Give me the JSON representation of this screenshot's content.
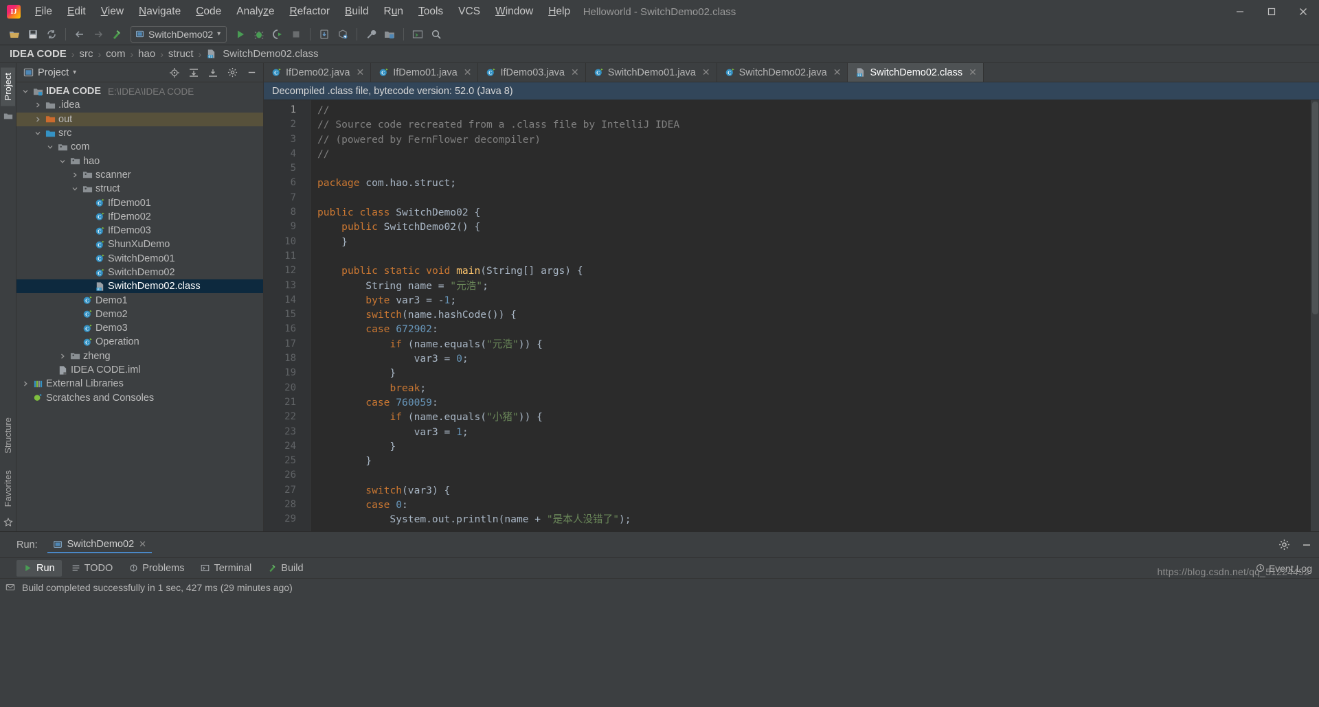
{
  "window": {
    "title": "Helloworld - SwitchDemo02.class",
    "logo_text": "IJ",
    "minimize": "–",
    "maximize": "❐",
    "close": "✕"
  },
  "menubar": {
    "items": [
      {
        "label": "File",
        "mnemonic": "F"
      },
      {
        "label": "Edit",
        "mnemonic": "E"
      },
      {
        "label": "View",
        "mnemonic": "V"
      },
      {
        "label": "Navigate",
        "mnemonic": "N"
      },
      {
        "label": "Code",
        "mnemonic": "C"
      },
      {
        "label": "Analyze",
        "mnemonic": "z"
      },
      {
        "label": "Refactor",
        "mnemonic": "R"
      },
      {
        "label": "Build",
        "mnemonic": "B"
      },
      {
        "label": "Run",
        "mnemonic": "u"
      },
      {
        "label": "Tools",
        "mnemonic": "T"
      },
      {
        "label": "VCS",
        "mnemonic": ""
      },
      {
        "label": "Window",
        "mnemonic": "W"
      },
      {
        "label": "Help",
        "mnemonic": "H"
      }
    ]
  },
  "toolbar": {
    "open_icon": "open-folder-icon",
    "save_icon": "save-icon",
    "sync_icon": "sync-icon",
    "back_icon": "back-arrow-icon",
    "forward_icon": "forward-arrow-icon",
    "build_icon": "hammer-icon",
    "run_config": "SwitchDemo02",
    "run_icon": "run-icon",
    "debug_icon": "debug-icon",
    "coverage_icon": "run-with-coverage-icon",
    "stop_icon": "stop-icon",
    "settings_icon": "wrench-icon",
    "project_structure_icon": "project-structure-icon",
    "terminal_icon": "terminal-icon",
    "search_icon": "search-everywhere-icon"
  },
  "breadcrumb": {
    "items": [
      "IDEA CODE",
      "src",
      "com",
      "hao",
      "struct",
      "SwitchDemo02.class"
    ],
    "separator": "›"
  },
  "left_strip": {
    "project_tab": "Project",
    "structure_tab": "Structure",
    "favorites_tab": "Favorites"
  },
  "project_panel": {
    "title": "Project",
    "dropdown": "▾",
    "actions": [
      "locate-icon",
      "expand-all-icon",
      "collapse-all-icon",
      "gear-icon",
      "hide-icon"
    ],
    "tree": [
      {
        "label": "IDEA CODE",
        "path": "E:\\IDEA\\IDEA CODE",
        "indent": 0,
        "arrow": "down",
        "icon": "module-folder-icon",
        "bold": true,
        "state": "normal"
      },
      {
        "label": ".idea",
        "path": "",
        "indent": 1,
        "arrow": "right",
        "icon": "folder-icon",
        "bold": false,
        "state": "normal"
      },
      {
        "label": "out",
        "path": "",
        "indent": 1,
        "arrow": "right",
        "icon": "folder-orange-icon",
        "bold": false,
        "state": "highlighted"
      },
      {
        "label": "src",
        "path": "",
        "indent": 1,
        "arrow": "down",
        "icon": "folder-source-icon",
        "bold": false,
        "state": "normal"
      },
      {
        "label": "com",
        "path": "",
        "indent": 2,
        "arrow": "down",
        "icon": "package-icon",
        "bold": false,
        "state": "normal"
      },
      {
        "label": "hao",
        "path": "",
        "indent": 3,
        "arrow": "down",
        "icon": "package-icon",
        "bold": false,
        "state": "normal"
      },
      {
        "label": "scanner",
        "path": "",
        "indent": 4,
        "arrow": "right",
        "icon": "package-icon",
        "bold": false,
        "state": "normal"
      },
      {
        "label": "struct",
        "path": "",
        "indent": 4,
        "arrow": "down",
        "icon": "package-icon",
        "bold": false,
        "state": "normal"
      },
      {
        "label": "IfDemo01",
        "path": "",
        "indent": 5,
        "arrow": "none",
        "icon": "java-class-icon",
        "bold": false,
        "state": "normal"
      },
      {
        "label": "IfDemo02",
        "path": "",
        "indent": 5,
        "arrow": "none",
        "icon": "java-class-icon",
        "bold": false,
        "state": "normal"
      },
      {
        "label": "IfDemo03",
        "path": "",
        "indent": 5,
        "arrow": "none",
        "icon": "java-class-icon",
        "bold": false,
        "state": "normal"
      },
      {
        "label": "ShunXuDemo",
        "path": "",
        "indent": 5,
        "arrow": "none",
        "icon": "java-class-icon",
        "bold": false,
        "state": "normal"
      },
      {
        "label": "SwitchDemo01",
        "path": "",
        "indent": 5,
        "arrow": "none",
        "icon": "java-class-icon",
        "bold": false,
        "state": "normal"
      },
      {
        "label": "SwitchDemo02",
        "path": "",
        "indent": 5,
        "arrow": "none",
        "icon": "java-class-icon",
        "bold": false,
        "state": "normal"
      },
      {
        "label": "SwitchDemo02.class",
        "path": "",
        "indent": 5,
        "arrow": "none",
        "icon": "class-file-icon",
        "bold": false,
        "state": "selected"
      },
      {
        "label": "Demo1",
        "path": "",
        "indent": 4,
        "arrow": "none",
        "icon": "java-class-icon",
        "bold": false,
        "state": "normal"
      },
      {
        "label": "Demo2",
        "path": "",
        "indent": 4,
        "arrow": "none",
        "icon": "java-class-icon",
        "bold": false,
        "state": "normal"
      },
      {
        "label": "Demo3",
        "path": "",
        "indent": 4,
        "arrow": "none",
        "icon": "java-class-icon",
        "bold": false,
        "state": "normal"
      },
      {
        "label": "Operation",
        "path": "",
        "indent": 4,
        "arrow": "none",
        "icon": "java-class-icon",
        "bold": false,
        "state": "normal"
      },
      {
        "label": "zheng",
        "path": "",
        "indent": 3,
        "arrow": "right",
        "icon": "package-icon",
        "bold": false,
        "state": "normal"
      },
      {
        "label": "IDEA CODE.iml",
        "path": "",
        "indent": 2,
        "arrow": "none",
        "icon": "iml-file-icon",
        "bold": false,
        "state": "normal"
      },
      {
        "label": "External Libraries",
        "path": "",
        "indent": 0,
        "arrow": "right",
        "icon": "libraries-icon",
        "bold": false,
        "state": "normal"
      },
      {
        "label": "Scratches and Consoles",
        "path": "",
        "indent": 0,
        "arrow": "none",
        "icon": "scratches-icon",
        "bold": false,
        "state": "normal"
      }
    ]
  },
  "editor": {
    "tabs": [
      {
        "label": "IfDemo02.java",
        "icon": "java-class-icon",
        "active": false,
        "close": "✕"
      },
      {
        "label": "IfDemo01.java",
        "icon": "java-class-icon",
        "active": false,
        "close": "✕"
      },
      {
        "label": "IfDemo03.java",
        "icon": "java-class-icon",
        "active": false,
        "close": "✕"
      },
      {
        "label": "SwitchDemo01.java",
        "icon": "java-class-icon",
        "active": false,
        "close": "✕"
      },
      {
        "label": "SwitchDemo02.java",
        "icon": "java-class-icon",
        "active": false,
        "close": "✕"
      },
      {
        "label": "SwitchDemo02.class",
        "icon": "class-file-icon",
        "active": true,
        "close": "✕"
      }
    ],
    "notice": "Decompiled .class file, bytecode version: 52.0 (Java 8)",
    "first_line": 1,
    "last_line": 29,
    "lines": [
      {
        "n": 1,
        "tokens": [
          {
            "t": "//",
            "c": "cm"
          }
        ]
      },
      {
        "n": 2,
        "tokens": [
          {
            "t": "// Source code recreated from a .class file by IntelliJ IDEA",
            "c": "cm"
          }
        ]
      },
      {
        "n": 3,
        "tokens": [
          {
            "t": "// (powered by FernFlower decompiler)",
            "c": "cm"
          }
        ]
      },
      {
        "n": 4,
        "tokens": [
          {
            "t": "//",
            "c": "cm"
          }
        ]
      },
      {
        "n": 5,
        "tokens": [
          {
            "t": "",
            "c": "id"
          }
        ]
      },
      {
        "n": 6,
        "tokens": [
          {
            "t": "package",
            "c": "kw"
          },
          {
            "t": " com.hao.struct;",
            "c": "id"
          }
        ]
      },
      {
        "n": 7,
        "tokens": [
          {
            "t": "",
            "c": "id"
          }
        ]
      },
      {
        "n": 8,
        "tokens": [
          {
            "t": "public class",
            "c": "kw"
          },
          {
            "t": " SwitchDemo02 {",
            "c": "id"
          }
        ]
      },
      {
        "n": 9,
        "tokens": [
          {
            "t": "    ",
            "c": "id"
          },
          {
            "t": "public",
            "c": "kw"
          },
          {
            "t": " SwitchDemo02() {",
            "c": "id"
          }
        ]
      },
      {
        "n": 10,
        "tokens": [
          {
            "t": "    }",
            "c": "id"
          }
        ]
      },
      {
        "n": 11,
        "tokens": [
          {
            "t": "",
            "c": "id"
          }
        ]
      },
      {
        "n": 12,
        "tokens": [
          {
            "t": "    ",
            "c": "id"
          },
          {
            "t": "public static void",
            "c": "kw"
          },
          {
            "t": " ",
            "c": "id"
          },
          {
            "t": "main",
            "c": "fn"
          },
          {
            "t": "(String[] args) {",
            "c": "id"
          }
        ]
      },
      {
        "n": 13,
        "tokens": [
          {
            "t": "        String name = ",
            "c": "id"
          },
          {
            "t": "\"元浩\"",
            "c": "st"
          },
          {
            "t": ";",
            "c": "id"
          }
        ]
      },
      {
        "n": 14,
        "tokens": [
          {
            "t": "        ",
            "c": "id"
          },
          {
            "t": "byte",
            "c": "kw"
          },
          {
            "t": " var3 = -",
            "c": "id"
          },
          {
            "t": "1",
            "c": "nm"
          },
          {
            "t": ";",
            "c": "id"
          }
        ]
      },
      {
        "n": 15,
        "tokens": [
          {
            "t": "        ",
            "c": "id"
          },
          {
            "t": "switch",
            "c": "kw"
          },
          {
            "t": "(name.hashCode()) {",
            "c": "id"
          }
        ]
      },
      {
        "n": 16,
        "tokens": [
          {
            "t": "        ",
            "c": "id"
          },
          {
            "t": "case",
            "c": "kw"
          },
          {
            "t": " ",
            "c": "id"
          },
          {
            "t": "672902",
            "c": "nm"
          },
          {
            "t": ":",
            "c": "id"
          }
        ]
      },
      {
        "n": 17,
        "tokens": [
          {
            "t": "            ",
            "c": "id"
          },
          {
            "t": "if",
            "c": "kw"
          },
          {
            "t": " (name.equals(",
            "c": "id"
          },
          {
            "t": "\"元浩\"",
            "c": "st"
          },
          {
            "t": ")) {",
            "c": "id"
          }
        ]
      },
      {
        "n": 18,
        "tokens": [
          {
            "t": "                var3 = ",
            "c": "id"
          },
          {
            "t": "0",
            "c": "nm"
          },
          {
            "t": ";",
            "c": "id"
          }
        ]
      },
      {
        "n": 19,
        "tokens": [
          {
            "t": "            }",
            "c": "id"
          }
        ]
      },
      {
        "n": 20,
        "tokens": [
          {
            "t": "            ",
            "c": "id"
          },
          {
            "t": "break",
            "c": "kw"
          },
          {
            "t": ";",
            "c": "id"
          }
        ]
      },
      {
        "n": 21,
        "tokens": [
          {
            "t": "        ",
            "c": "id"
          },
          {
            "t": "case",
            "c": "kw"
          },
          {
            "t": " ",
            "c": "id"
          },
          {
            "t": "760059",
            "c": "nm"
          },
          {
            "t": ":",
            "c": "id"
          }
        ]
      },
      {
        "n": 22,
        "tokens": [
          {
            "t": "            ",
            "c": "id"
          },
          {
            "t": "if",
            "c": "kw"
          },
          {
            "t": " (name.equals(",
            "c": "id"
          },
          {
            "t": "\"小猪\"",
            "c": "st"
          },
          {
            "t": ")) {",
            "c": "id"
          }
        ]
      },
      {
        "n": 23,
        "tokens": [
          {
            "t": "                var3 = ",
            "c": "id"
          },
          {
            "t": "1",
            "c": "nm"
          },
          {
            "t": ";",
            "c": "id"
          }
        ]
      },
      {
        "n": 24,
        "tokens": [
          {
            "t": "            }",
            "c": "id"
          }
        ]
      },
      {
        "n": 25,
        "tokens": [
          {
            "t": "        }",
            "c": "id"
          }
        ]
      },
      {
        "n": 26,
        "tokens": [
          {
            "t": "",
            "c": "id"
          }
        ]
      },
      {
        "n": 27,
        "tokens": [
          {
            "t": "        ",
            "c": "id"
          },
          {
            "t": "switch",
            "c": "kw"
          },
          {
            "t": "(var3) {",
            "c": "id"
          }
        ]
      },
      {
        "n": 28,
        "tokens": [
          {
            "t": "        ",
            "c": "id"
          },
          {
            "t": "case",
            "c": "kw"
          },
          {
            "t": " ",
            "c": "id"
          },
          {
            "t": "0",
            "c": "nm"
          },
          {
            "t": ":",
            "c": "id"
          }
        ]
      },
      {
        "n": 29,
        "tokens": [
          {
            "t": "            System.out.println(name + ",
            "c": "id"
          },
          {
            "t": "\"是本人没错了\"",
            "c": "st"
          },
          {
            "t": ");",
            "c": "id"
          }
        ]
      }
    ]
  },
  "run_panel": {
    "label": "Run:",
    "tab_label": "SwitchDemo02",
    "tab_icon": "run-tab-icon",
    "close": "✕",
    "settings_icon": "gear-icon",
    "hide_icon": "hide-icon"
  },
  "bottom_tabs": [
    {
      "label": "Run",
      "icon": "run-icon",
      "active": true
    },
    {
      "label": "TODO",
      "icon": "todo-icon",
      "active": false
    },
    {
      "label": "Problems",
      "icon": "problems-icon",
      "active": false
    },
    {
      "label": "Terminal",
      "icon": "terminal-icon",
      "active": false
    },
    {
      "label": "Build",
      "icon": "build-icon",
      "active": false
    }
  ],
  "status_bar": {
    "message": "Build completed successfully in 1 sec, 427 ms (29 minutes ago)",
    "event_log": "Event Log",
    "event_log_icon": "event-log-icon",
    "message_icon": "message-icon"
  },
  "watermark": "https://blog.csdn.net/qq_51224492",
  "colors": {
    "background": "#3c3f41",
    "editor_bg": "#2b2b2b",
    "selection": "#0d293e",
    "accent": "#4a88c7",
    "notice_bg": "#32465a",
    "keyword": "#cc7832",
    "string": "#6a8759",
    "number": "#6897bb",
    "comment": "#808080",
    "identifier": "#a9b7c6",
    "method": "#ffc66d",
    "highlight_row": "#57513b"
  }
}
